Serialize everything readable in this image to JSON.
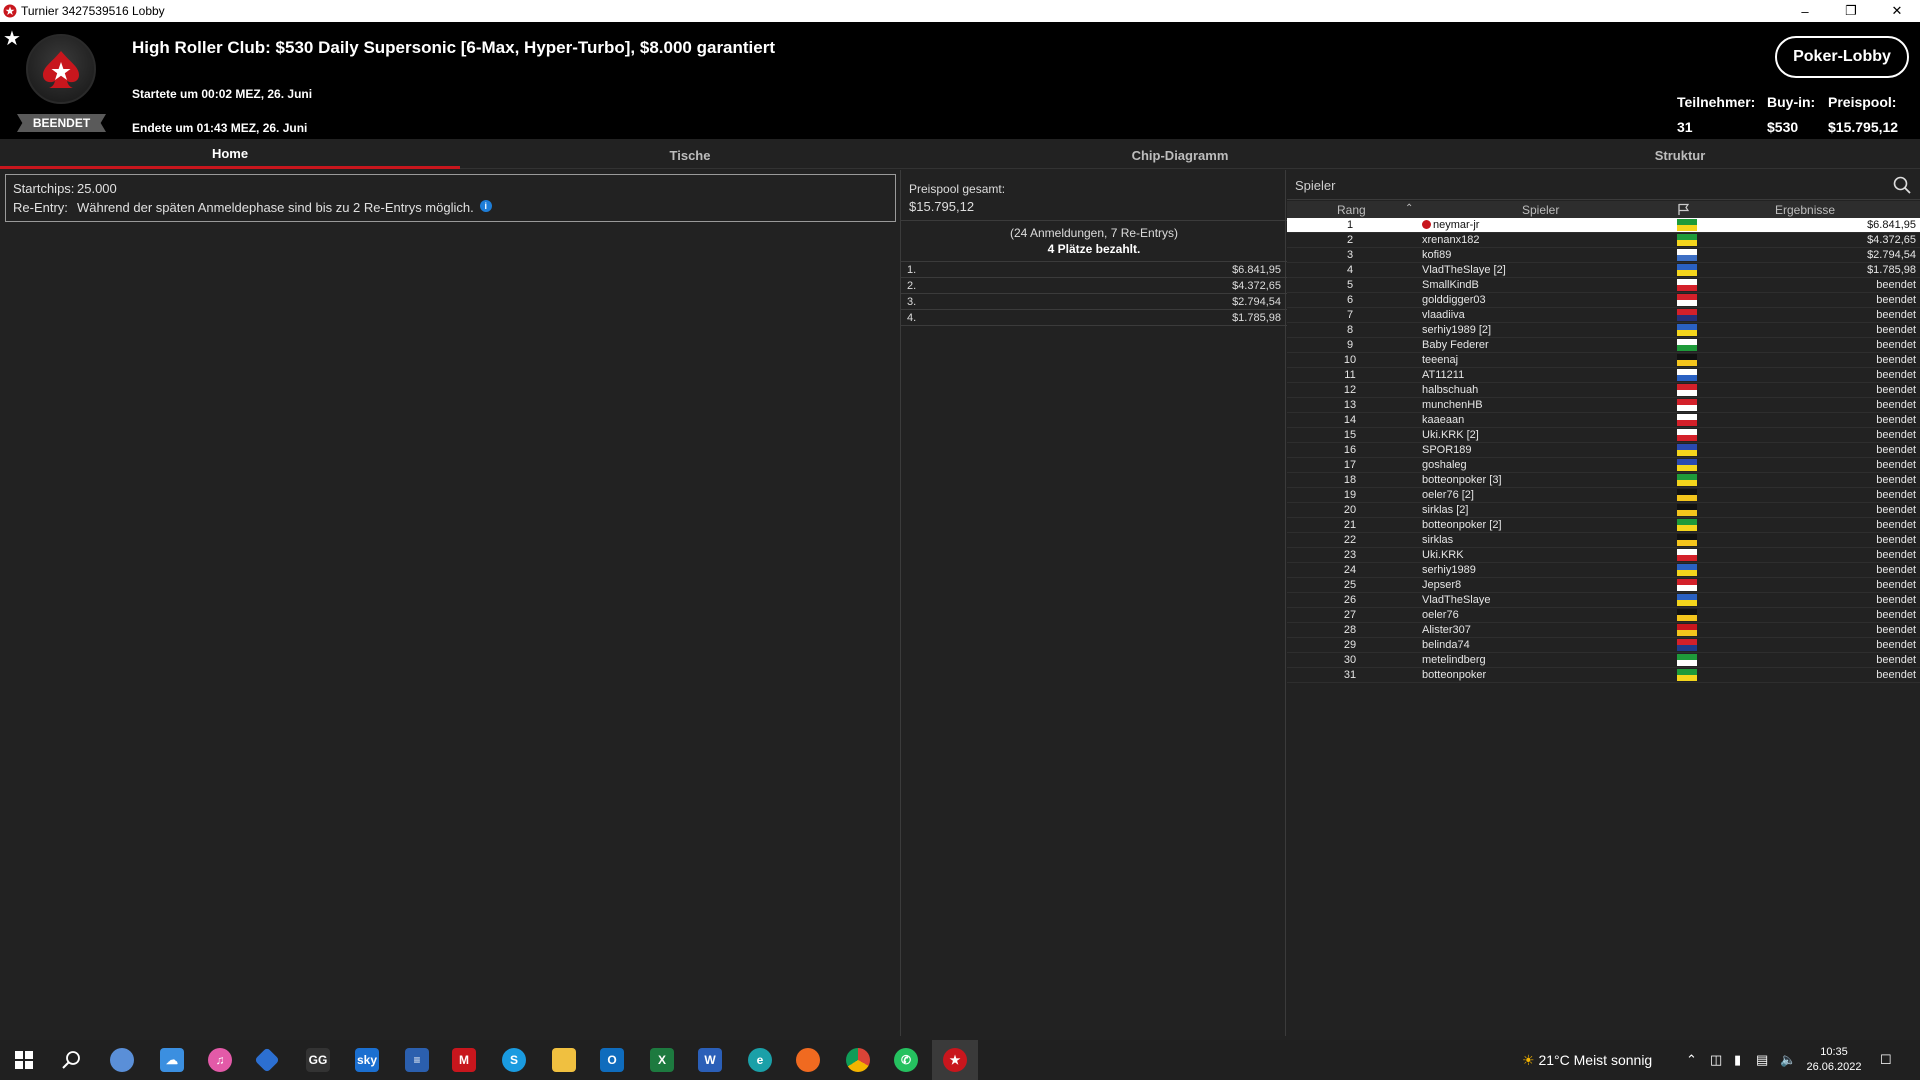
{
  "window": {
    "title": "Turnier 3427539516 Lobby",
    "minimize_icon": "minimize-icon",
    "restore_icon": "restore-icon",
    "close_icon": "close-icon"
  },
  "header": {
    "status": "BEENDET",
    "title": "High Roller Club: $530 Daily Supersonic [6-Max, Hyper-Turbo], $8.000 garantiert",
    "start": "Startete um 00:02 MEZ, 26. Juni",
    "end": "Endete um 01:43 MEZ, 26. Juni",
    "lobby_button": "Poker-Lobby",
    "participants_label": "Teilnehmer:",
    "participants_value": "31",
    "buyin_label": "Buy-in:",
    "buyin_value": "$530",
    "prizepool_label": "Preispool:",
    "prizepool_value": "$15.795,12"
  },
  "tabs": [
    {
      "label": "Home",
      "active": true
    },
    {
      "label": "Tische",
      "active": false
    },
    {
      "label": "Chip-Diagramm",
      "active": false
    },
    {
      "label": "Struktur",
      "active": false
    }
  ],
  "info": {
    "startchips_label": "Startchips:",
    "startchips_value": "25.000",
    "reentry_label": "Re-Entry:",
    "reentry_value": "Während der späten Anmeldephase sind bis zu 2 Re-Entrys möglich."
  },
  "prize": {
    "total_label": "Preispool gesamt:",
    "total_value": "$15.795,12",
    "registrations": "(24 Anmeldungen, 7 Re-Entrys)",
    "paid": "4 Plätze bezahlt.",
    "payouts": [
      {
        "pos": "1.",
        "amount": "$6.841,95"
      },
      {
        "pos": "2.",
        "amount": "$4.372,65"
      },
      {
        "pos": "3.",
        "amount": "$2.794,54"
      },
      {
        "pos": "4.",
        "amount": "$1.785,98"
      }
    ]
  },
  "players": {
    "search_placeholder": "Spieler",
    "col_rank": "Rang",
    "col_player": "Spieler",
    "col_result": "Ergebnisse",
    "rows": [
      {
        "rank": "1",
        "name": "neymar-jr",
        "flag": "BR",
        "result": "$6.841,95",
        "me": true
      },
      {
        "rank": "2",
        "name": "xrenanx182",
        "flag": "BR",
        "result": "$4.372,65"
      },
      {
        "rank": "3",
        "name": "kofi89",
        "flag": "UY",
        "result": "$2.794,54"
      },
      {
        "rank": "4",
        "name": "VladTheSlaye [2]",
        "flag": "UA",
        "result": "$1.785,98"
      },
      {
        "rank": "5",
        "name": "SmallKindB",
        "flag": "CZ",
        "result": "beendet"
      },
      {
        "rank": "6",
        "name": "golddigger03",
        "flag": "DK",
        "result": "beendet"
      },
      {
        "rank": "7",
        "name": "vlaadiiva",
        "flag": "TH",
        "result": "beendet"
      },
      {
        "rank": "8",
        "name": "serhiy1989 [2]",
        "flag": "UA",
        "result": "beendet"
      },
      {
        "rank": "9",
        "name": "Baby Federer",
        "flag": "BG",
        "result": "beendet"
      },
      {
        "rank": "10",
        "name": "teeenaj",
        "flag": "DE",
        "result": "beendet"
      },
      {
        "rank": "11",
        "name": "AT11211",
        "flag": "FI",
        "result": "beendet"
      },
      {
        "rank": "12",
        "name": "halbschuah",
        "flag": "CH",
        "result": "beendet"
      },
      {
        "rank": "13",
        "name": "munchenHB",
        "flag": "AT",
        "result": "beendet"
      },
      {
        "rank": "14",
        "name": "kaaeaan",
        "flag": "JP",
        "result": "beendet"
      },
      {
        "rank": "15",
        "name": "Uki.KRK [2]",
        "flag": "PL",
        "result": "beendet"
      },
      {
        "rank": "16",
        "name": "SPOR189",
        "flag": "RO",
        "result": "beendet"
      },
      {
        "rank": "17",
        "name": "goshaleg",
        "flag": "RO",
        "result": "beendet"
      },
      {
        "rank": "18",
        "name": "botteonpoker [3]",
        "flag": "BR",
        "result": "beendet"
      },
      {
        "rank": "19",
        "name": "oeler76 [2]",
        "flag": "DE",
        "result": "beendet"
      },
      {
        "rank": "20",
        "name": "sirklas [2]",
        "flag": "DE",
        "result": "beendet"
      },
      {
        "rank": "21",
        "name": "botteonpoker [2]",
        "flag": "BR",
        "result": "beendet"
      },
      {
        "rank": "22",
        "name": "sirklas",
        "flag": "DE",
        "result": "beendet"
      },
      {
        "rank": "23",
        "name": "Uki.KRK",
        "flag": "PL",
        "result": "beendet"
      },
      {
        "rank": "24",
        "name": "serhiy1989",
        "flag": "UA",
        "result": "beendet"
      },
      {
        "rank": "25",
        "name": "Jepser8",
        "flag": "AT",
        "result": "beendet"
      },
      {
        "rank": "26",
        "name": "VladTheSlaye",
        "flag": "UA",
        "result": "beendet"
      },
      {
        "rank": "27",
        "name": "oeler76",
        "flag": "DE",
        "result": "beendet"
      },
      {
        "rank": "28",
        "name": "Alister307",
        "flag": "ES",
        "result": "beendet"
      },
      {
        "rank": "29",
        "name": "belinda74",
        "flag": "NO",
        "result": "beendet"
      },
      {
        "rank": "30",
        "name": "metelindberg",
        "flag": "MX",
        "result": "beendet"
      },
      {
        "rank": "31",
        "name": "botteonpoker",
        "flag": "BR",
        "result": "beendet"
      }
    ]
  },
  "taskbar": {
    "weather_temp": "21°C",
    "weather_text": "Meist sonnig",
    "time": "10:35",
    "date": "26.06.2022"
  },
  "colors": {
    "accent": "#c8161d",
    "background": "#222222",
    "header": "#000000"
  }
}
